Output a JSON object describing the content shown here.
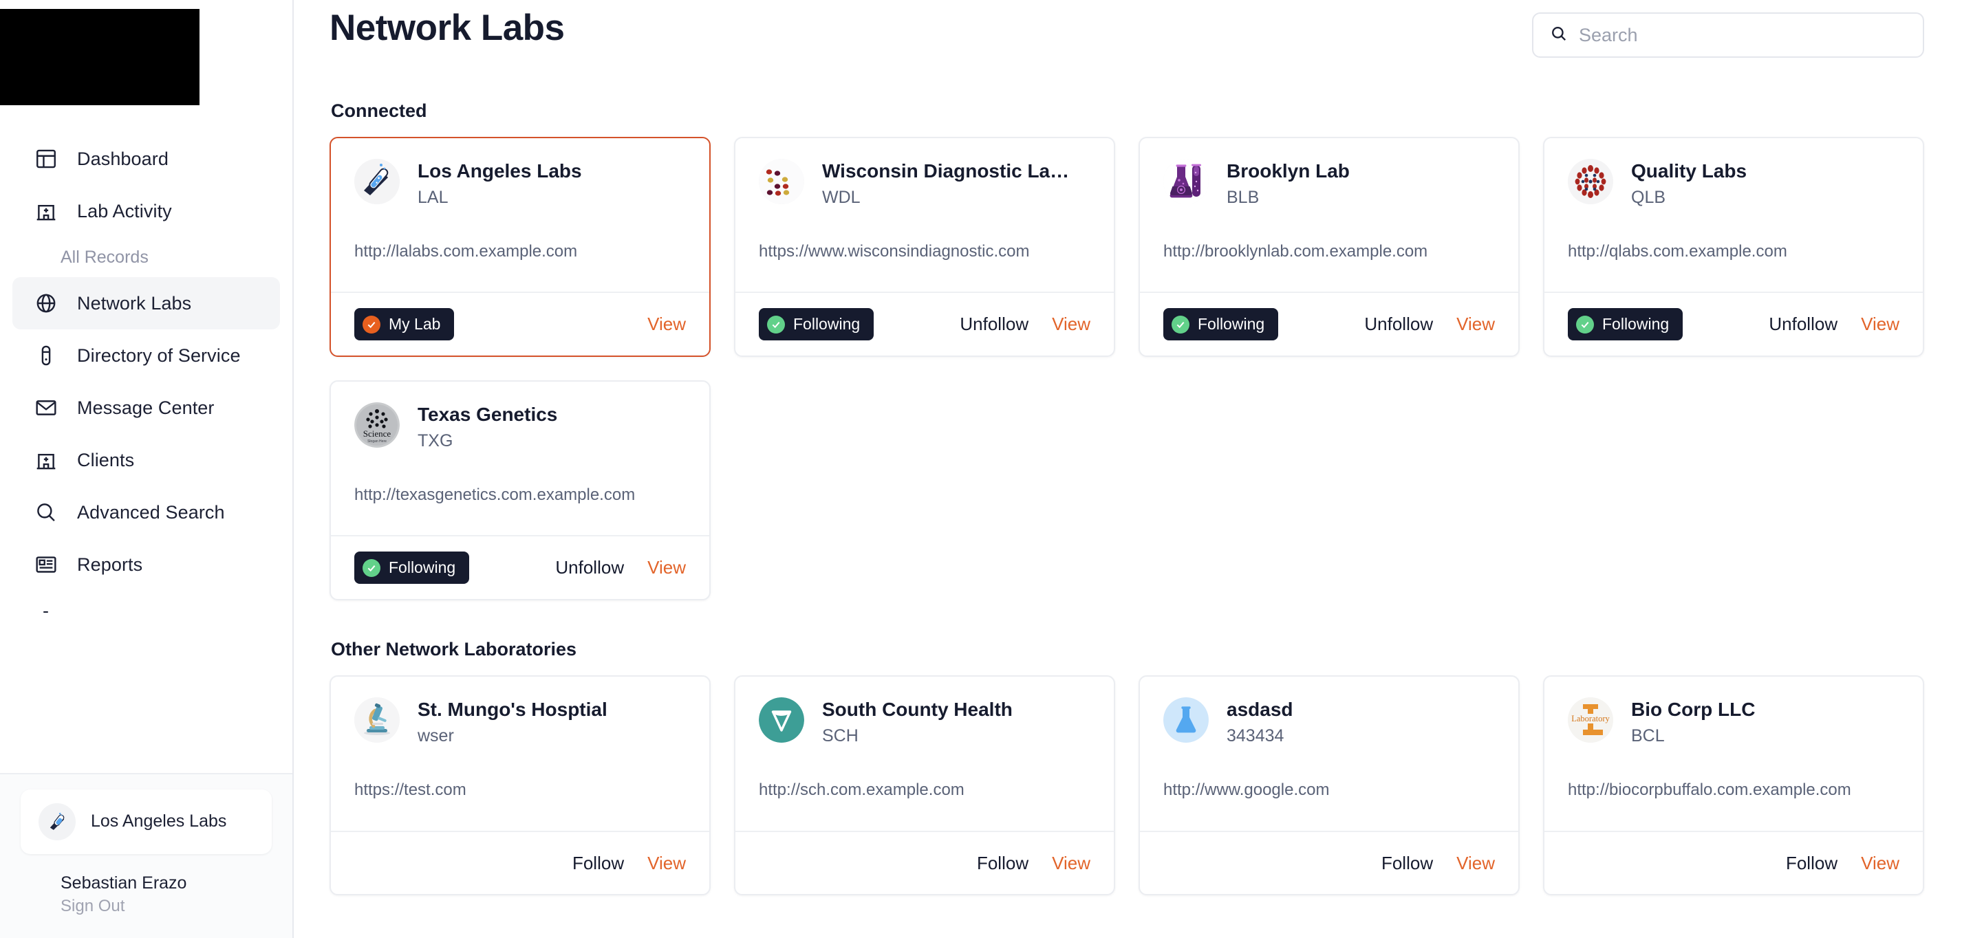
{
  "sidebar": {
    "logo_alt": "lab-logo",
    "nav": [
      {
        "label": "Dashboard",
        "icon": "dashboard-icon",
        "active": false,
        "type": "item"
      },
      {
        "label": "Lab Activity",
        "icon": "hospital-icon",
        "active": false,
        "type": "item"
      },
      {
        "label": "All Records",
        "icon": "",
        "active": false,
        "type": "sub"
      },
      {
        "label": "Network Labs",
        "icon": "globe-icon",
        "active": true,
        "type": "item"
      },
      {
        "label": "Directory of Service",
        "icon": "test-tube-icon",
        "active": false,
        "type": "item"
      },
      {
        "label": "Message Center",
        "icon": "envelope-icon",
        "active": false,
        "type": "item"
      },
      {
        "label": "Clients",
        "icon": "hospital-icon",
        "active": false,
        "type": "item"
      },
      {
        "label": "Advanced Search",
        "icon": "search-icon",
        "active": false,
        "type": "item"
      },
      {
        "label": "Reports",
        "icon": "report-icon",
        "active": false,
        "type": "item"
      },
      {
        "label": "-",
        "icon": "",
        "active": false,
        "type": "dash"
      }
    ],
    "footer": {
      "lab_name": "Los Angeles Labs",
      "lab_avatar_icon": "test-tube-avatar-icon",
      "user_name": "Sebastian Erazo",
      "sign_out_label": "Sign Out"
    }
  },
  "header": {
    "title": "Network Labs"
  },
  "search": {
    "placeholder": "Search",
    "value": "",
    "icon": "search-icon"
  },
  "sections": [
    {
      "title": "Connected"
    },
    {
      "title": "Other Network Laboratories"
    }
  ],
  "connected": [
    {
      "name": "Los Angeles Labs",
      "code": "LAL",
      "url": "http://lalabs.com.example.com",
      "logo": "la-labs-logo",
      "selected": true,
      "badge": "My Lab",
      "badge_type": "mylab",
      "secondary_action": "",
      "view_label": "View"
    },
    {
      "name": "Wisconsin Diagnostic Labor...",
      "code": "WDL",
      "url": "https://www.wisconsindiagnostic.com",
      "logo": "wisconsin-dots-logo",
      "selected": false,
      "badge": "Following",
      "badge_type": "following",
      "secondary_action": "Unfollow",
      "view_label": "View"
    },
    {
      "name": "Brooklyn Lab",
      "code": "BLB",
      "url": "http://brooklynlab.com.example.com",
      "logo": "brooklyn-flask-logo",
      "selected": false,
      "badge": "Following",
      "badge_type": "following",
      "secondary_action": "Unfollow",
      "view_label": "View"
    },
    {
      "name": "Quality Labs",
      "code": "QLB",
      "url": "http://qlabs.com.example.com",
      "logo": "quality-dots-logo",
      "selected": false,
      "badge": "Following",
      "badge_type": "following",
      "secondary_action": "Unfollow",
      "view_label": "View"
    },
    {
      "name": "Texas Genetics",
      "code": "TXG",
      "url": "http://texasgenetics.com.example.com",
      "logo": "science-badge-logo",
      "selected": false,
      "badge": "Following",
      "badge_type": "following",
      "secondary_action": "Unfollow",
      "view_label": "View"
    }
  ],
  "other": [
    {
      "name": "St. Mungo's Hosptial",
      "code": "wser",
      "url": "https://test.com",
      "logo": "microscope-logo",
      "badge": "",
      "badge_type": "",
      "secondary_action": "Follow",
      "view_label": "View"
    },
    {
      "name": "South County Health",
      "code": "SCH",
      "url": "http://sch.com.example.com",
      "logo": "teal-shield-logo",
      "badge": "",
      "badge_type": "",
      "secondary_action": "Follow",
      "view_label": "View"
    },
    {
      "name": "asdasd",
      "code": "343434",
      "url": "http://www.google.com",
      "logo": "blue-flask-logo",
      "badge": "",
      "badge_type": "",
      "secondary_action": "Follow",
      "view_label": "View"
    },
    {
      "name": "Bio Corp LLC",
      "code": "BCL",
      "url": "http://biocorpbuffalo.com.example.com",
      "logo": "laboratory-l-logo",
      "badge": "",
      "badge_type": "",
      "secondary_action": "Follow",
      "view_label": "View"
    }
  ],
  "colors": {
    "accent_orange": "#e2642a",
    "badge_dark": "#161b2e",
    "follow_green": "#62d18a",
    "mylab_orange": "#e8601f"
  }
}
